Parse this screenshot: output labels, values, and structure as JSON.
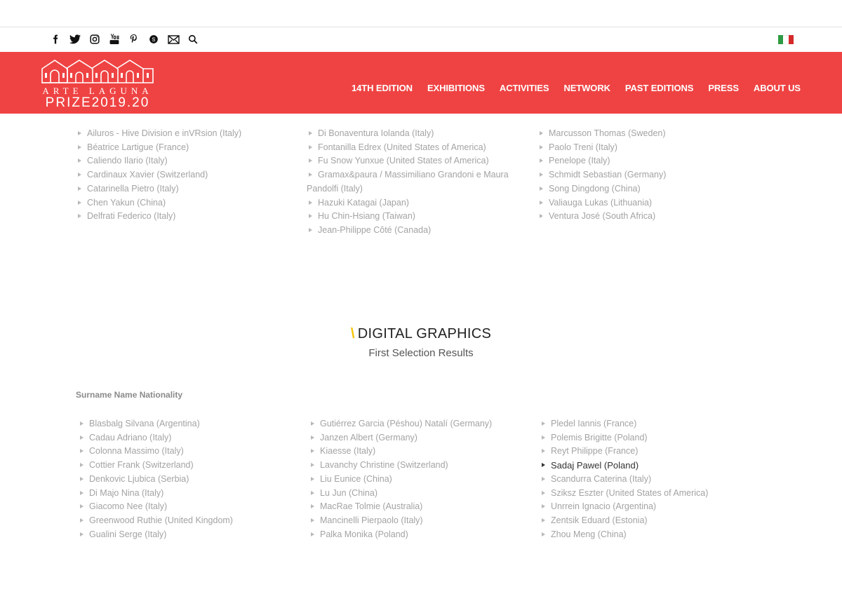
{
  "social": [
    "facebook-icon",
    "twitter-icon",
    "instagram-icon",
    "youtube-icon",
    "pinterest-icon",
    "skype-icon",
    "mail-icon",
    "search-icon"
  ],
  "flag_colors": [
    "#2e9b43",
    "#ffffff",
    "#d42a2a"
  ],
  "header": {
    "bg": "#ef4343",
    "logo_top": "ARTE LAGUNA",
    "logo_bottom": "PRIZE2019.20",
    "nav": [
      "14TH EDITION",
      "EXHIBITIONS",
      "ACTIVITIES",
      "NETWORK",
      "PAST EDITIONS",
      "PRESS",
      "ABOUT US"
    ]
  },
  "upper_lists": {
    "col1": [
      "Ailuros - Hive Division e inVRsion (Italy)",
      "Béatrice Lartigue (France)",
      "Caliendo Ilario (Italy)",
      "Cardinaux Xavier (Switzerland)",
      "Catarinella Pietro (Italy)",
      "Chen Yakun (China)",
      "Delfrati Federico (Italy)"
    ],
    "col2": [
      "Di Bonaventura Iolanda (Italy)",
      "Fontanilla Edrex (United States of America)",
      "Fu Snow Yunxue (United States of America)",
      "Gramax&paura / Massimiliano Grandoni e Maura Pandolfi (Italy)",
      "Hazuki Katagai (Japan)",
      "Hu Chin-Hsiang (Taiwan)",
      "Jean-Philippe Côté (Canada)"
    ],
    "col3": [
      "Marcusson Thomas (Sweden)",
      "Paolo Treni (Italy)",
      "Penelope (Italy)",
      "Schmidt Sebastian (Germany)",
      "Song Dingdong (China)",
      "Valiauga Lukas (Lithuania)",
      "Ventura José (South Africa)"
    ]
  },
  "section": {
    "slash": "\\",
    "title": "DIGITAL GRAPHICS",
    "subtitle": "First Selection Results",
    "legend": "Surname Name Nationality"
  },
  "lower_lists": {
    "col1": [
      "Blasbalg Silvana (Argentina)",
      "Cadau Adriano (Italy)",
      "Colonna Massimo (Italy)",
      "Cottier Frank (Switzerland)",
      "Denkovic Ljubica (Serbia)",
      "Di Majo Nina (Italy)",
      "Giacomo Nee (Italy)",
      "Greenwood Ruthie (United Kingdom)",
      "Gualini Serge (Italy)"
    ],
    "col2": [
      "Gutiérrez Garcia (Péshou) Natalí (Germany)",
      "Janzen Albert (Germany)",
      "Kiaesse (Italy)",
      "Lavanchy Christine (Switzerland)",
      "Liu Eunice (China)",
      "Lu Jun (China)",
      "MacRae Tolmie (Australia)",
      "Mancinelli Pierpaolo (Italy)",
      "Palka Monika (Poland)"
    ],
    "col3": [
      "Pledel Iannis (France)",
      "Polemis Brigitte (Poland)",
      "Reyt Philippe (France)",
      "Sadaj Pawel (Poland)",
      "Scandurra Caterina (Italy)",
      "Sziksz Eszter (United States of America)",
      "Unrrein Ignacio (Argentina)",
      "Zentsik Eduard (Estonia)",
      "Zhou Meng (China)"
    ]
  }
}
